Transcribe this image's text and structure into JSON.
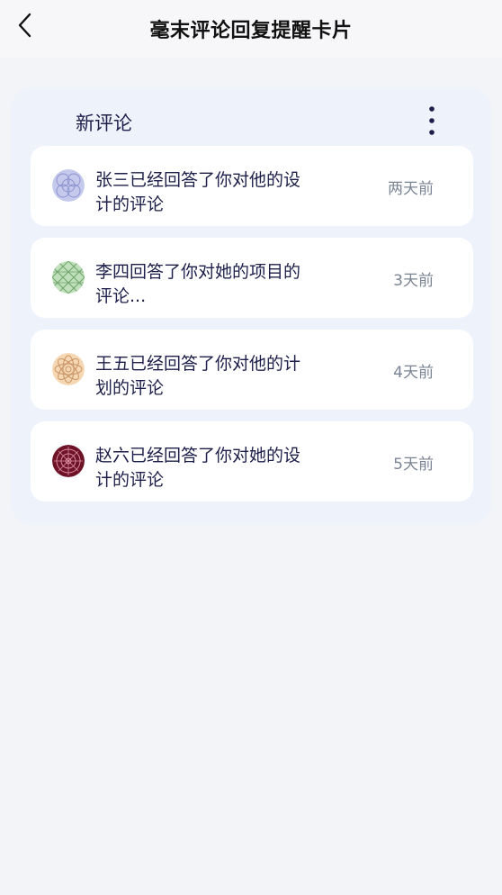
{
  "header": {
    "title": "毫末评论回复提醒卡片",
    "back_icon": "chevron-left-icon"
  },
  "card": {
    "title": "新评论",
    "more_icon": "more-vertical-icon"
  },
  "comments": [
    {
      "text": "张三已经回答了你对他的设计的评论",
      "time": "两天前",
      "avatar_color": "#c5c9ec"
    },
    {
      "text": "李四回答了你对她的项目的评论...",
      "time": "3天前",
      "avatar_color": "#bfe0bb"
    },
    {
      "text": "王五已经回答了你对他的计划的评论",
      "time": "4天前",
      "avatar_color": "#f6d7b3"
    },
    {
      "text": "赵六已经回答了你对她的设计的评论",
      "time": "5天前",
      "avatar_color": "#6e1228"
    }
  ],
  "colors": {
    "background": "#f3f4f8",
    "card_background": "#eef2fb",
    "item_background": "#ffffff",
    "primary_text": "#1d1f4a",
    "secondary_text": "#7b8494"
  }
}
